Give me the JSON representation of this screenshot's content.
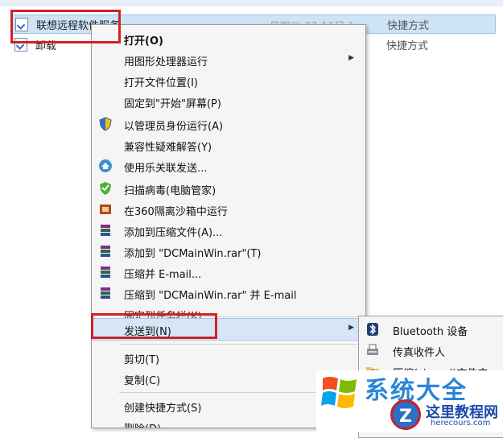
{
  "explorer": {
    "rows": [
      {
        "name": "联想远程软件服务",
        "date": "星期二 27 11日 1...",
        "type": "快捷方式"
      },
      {
        "name": "卸载",
        "date": "...",
        "type": "快捷方式"
      }
    ]
  },
  "context_menu": {
    "items": [
      {
        "label": "打开(O)",
        "icon": ""
      },
      {
        "label": "用图形处理器运行",
        "icon": ""
      },
      {
        "label": "打开文件位置(I)",
        "icon": ""
      },
      {
        "label": "固定到\"开始\"屏幕(P)",
        "icon": ""
      },
      {
        "label": "以管理员身份运行(A)",
        "icon": "shield-icon"
      },
      {
        "label": "兼容性疑难解答(Y)",
        "icon": ""
      },
      {
        "label": "使用乐关联发送...",
        "icon": "share-app-icon"
      },
      {
        "label": "扫描病毒(电脑管家)",
        "icon": "antivirus-shield-icon"
      },
      {
        "label": "在360隔离沙箱中运行",
        "icon": "sandbox-icon"
      },
      {
        "label": "添加到压缩文件(A)...",
        "icon": "winrar-icon"
      },
      {
        "label": "添加到 \"DCMainWin.rar\"(T)",
        "icon": "winrar-icon"
      },
      {
        "label": "压缩并 E-mail...",
        "icon": "winrar-icon"
      },
      {
        "label": "压缩到 \"DCMainWin.rar\" 并 E-mail",
        "icon": "winrar-icon"
      },
      {
        "label": "固定到任务栏(K)",
        "icon": ""
      },
      {
        "label": "发送到(N)",
        "icon": ""
      },
      {
        "label": "剪切(T)",
        "icon": ""
      },
      {
        "label": "复制(C)",
        "icon": ""
      },
      {
        "label": "创建快捷方式(S)",
        "icon": ""
      },
      {
        "label": "删除(D)",
        "icon": ""
      }
    ]
  },
  "send_to_submenu": {
    "items": [
      {
        "label": "Bluetooth 设备",
        "icon": "bluetooth-icon"
      },
      {
        "label": "传真收件人",
        "icon": "fax-icon"
      },
      {
        "label": "压缩(zipped)文件夹",
        "icon": "zip-folder-icon"
      }
    ]
  },
  "watermark": {
    "title": "系统大全",
    "site_cn": "这里教程网",
    "site_url": "herecours.com",
    "badge": "Z",
    "w": "W"
  },
  "colors": {
    "highlight_box": "#d0202a",
    "selection": "#cfe3f7",
    "menu_bg": "#f5f5f5"
  }
}
